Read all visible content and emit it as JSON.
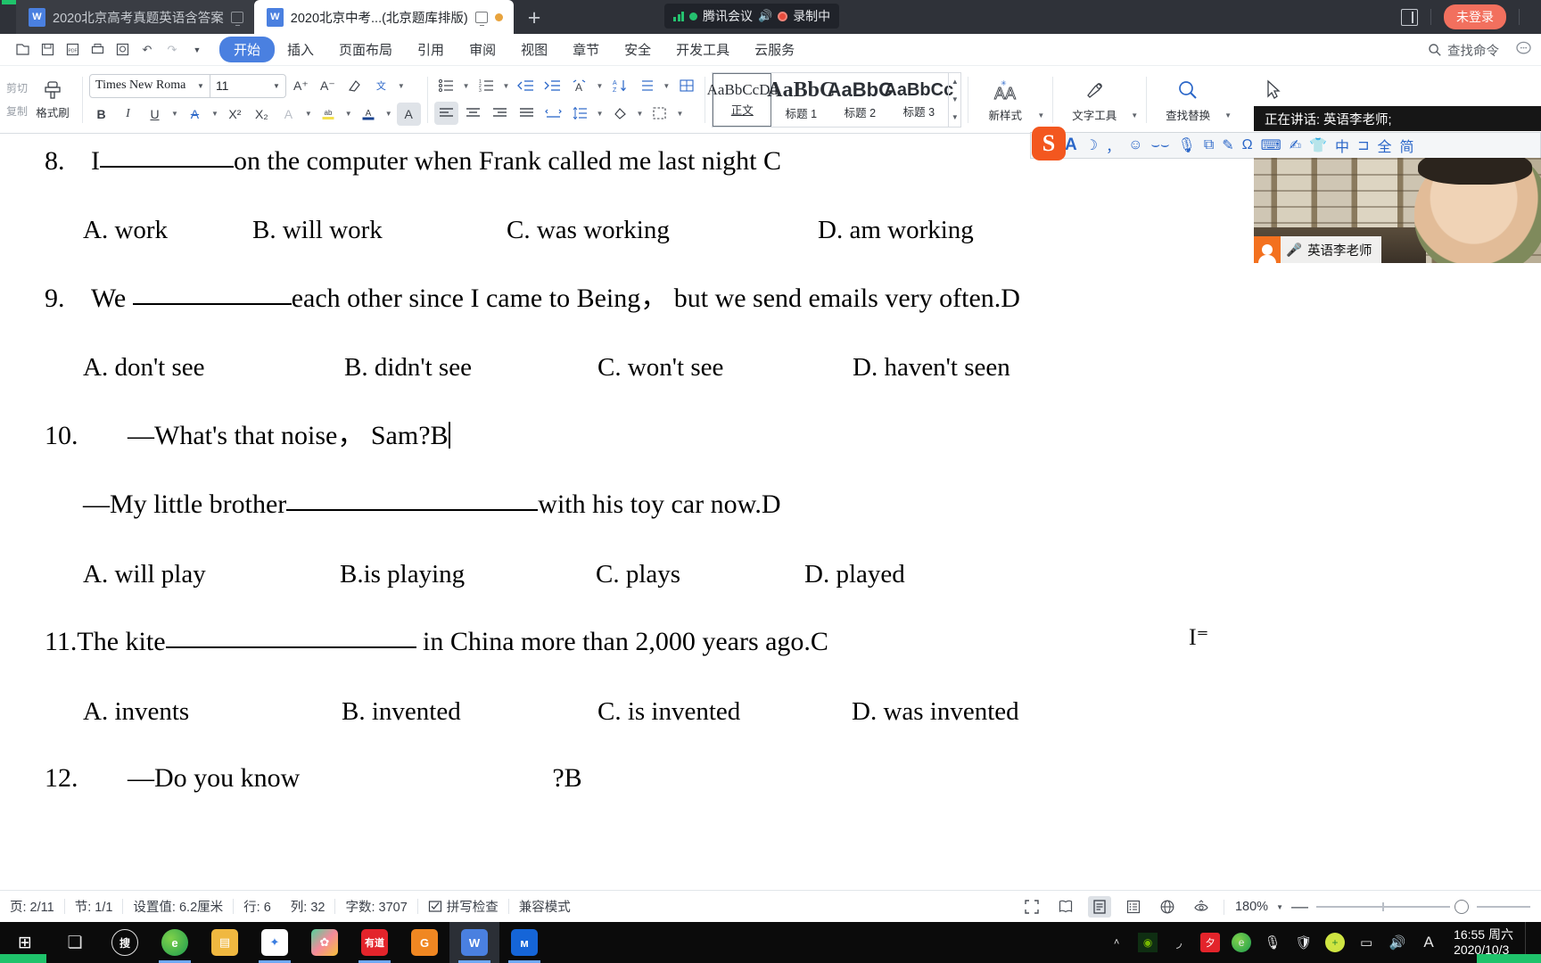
{
  "window": {
    "tabs": [
      {
        "title": "2020北京高考真题英语含答案",
        "state": "inactive",
        "icon": "word-doc-icon"
      },
      {
        "title": "2020北京中考...(北京题库排版)",
        "state": "active",
        "icon": "word-doc-icon"
      }
    ],
    "new_tab_label": "+",
    "meeting_pill": {
      "app": "腾讯会议",
      "recording": "录制中"
    },
    "login_button": "未登录"
  },
  "menubar": {
    "quick_icons": [
      "new-file-icon",
      "save-icon",
      "export-pdf-icon",
      "print-icon",
      "print-preview-icon",
      "undo-icon",
      "redo-icon",
      "customize-caret-icon"
    ],
    "items": [
      {
        "label": "开始",
        "active": true
      },
      {
        "label": "插入",
        "active": false
      },
      {
        "label": "页面布局",
        "active": false
      },
      {
        "label": "引用",
        "active": false
      },
      {
        "label": "审阅",
        "active": false
      },
      {
        "label": "视图",
        "active": false
      },
      {
        "label": "章节",
        "active": false
      },
      {
        "label": "安全",
        "active": false
      },
      {
        "label": "开发工具",
        "active": false
      },
      {
        "label": "云服务",
        "active": false
      }
    ],
    "find_command": "查找命令"
  },
  "ribbon": {
    "clipboard": {
      "cut": "剪切",
      "copy": "复制",
      "format_painter": "格式刷"
    },
    "font": {
      "name": "Times New Roma",
      "size": "11"
    },
    "styles": [
      {
        "sample": "AaBbCcDd",
        "name": "正文",
        "selected": true
      },
      {
        "sample": "AaBbC",
        "name": "标题 1",
        "selected": false
      },
      {
        "sample": "AaBbC",
        "name": "标题 2",
        "selected": false
      },
      {
        "sample": "AaBbCc",
        "name": "标题 3",
        "selected": false
      }
    ],
    "new_style": "新样式",
    "text_tools": "文字工具",
    "find_replace": "查找替换",
    "select": "选择"
  },
  "overlays": {
    "speaking": "正在讲话: 英语李老师;",
    "video_name": "英语李老师",
    "sogou_logo": "S",
    "sogou_tools": [
      "A",
      "moon-icon",
      "comma-icon",
      "smiley-icon",
      "expression-icon",
      "mic-icon",
      "screenshot-icon",
      "pen-icon",
      "omega-icon",
      "keyboard-icon",
      "handwriting-icon",
      "skin-icon",
      "translate-icon",
      "crop-icon",
      "full-width-icon",
      "simplified-icon"
    ]
  },
  "document": {
    "questions": [
      {
        "num": "8.",
        "text_before": "I",
        "blank_width": 150,
        "text_after": "on the computer when Frank called me last night C",
        "options": [
          "A. work",
          "B. will work",
          "C. was working",
          "D. am working"
        ]
      },
      {
        "num": "9.",
        "text_before": "We ",
        "blank_width": 178,
        "text_after": "each other since I came to Being，  but we send emails very often.D",
        "options": [
          "A.    don't see",
          "B. didn't see",
          "C. won't see",
          "D. haven't seen"
        ]
      },
      {
        "num": "10.",
        "line1": "—What's that noise，  Sam?B",
        "line2_before": "—My little brother",
        "line2_blank": 282,
        "line2_after": "with his toy car now.D",
        "options": [
          "A.    will play",
          "B.is playing",
          "C. plays",
          "D. played"
        ]
      },
      {
        "num": "11.",
        "text_before": "The kite",
        "blank_width": 281,
        "text_after": " in China more than 2,000 years ago.C",
        "options": [
          "A.    invents",
          "B. invented",
          "C. is invented",
          "D. was invented"
        ]
      },
      {
        "num": "12.",
        "text_before": "—Do you know",
        "text_after": "?B"
      }
    ]
  },
  "statusbar": {
    "page": "页: 2/11",
    "section": "节: 1/1",
    "value": "设置值: 6.2厘米",
    "row": "行: 6",
    "col": "列: 32",
    "words": "字数: 3707",
    "spellcheck": "拼写检查",
    "compat": "兼容模式",
    "zoom": "180%",
    "view_buttons": [
      "fullscreen-icon",
      "two-page-view-icon",
      "page-view-icon",
      "outline-view-icon",
      "web-view-icon",
      "eye-protect-icon"
    ]
  },
  "taskbar": {
    "start": "start-icon",
    "items": [
      "task-view-icon",
      "sogou-search-icon",
      "edge-browser-icon",
      "file-explorer-icon",
      "qq-mail-icon",
      "xmind-icon",
      "youdao-icon",
      "pdf-icon",
      "wps-writer-icon",
      "meitu-icon"
    ],
    "tray": [
      "nvidia-icon",
      "wifi-icon",
      "qq-icon",
      "360-browser-icon",
      "mic-icon",
      "security-shield-icon",
      "360-safe-icon",
      "battery-icon",
      "volume-icon",
      "ime-A-icon"
    ],
    "clock_time": "16:55 周六",
    "clock_date": "2020/10/3"
  },
  "colors": {
    "tabbar_bg": "#2f3239",
    "accent_blue": "#4a80e0",
    "login_red": "#f2705e",
    "green": "#1fc36b",
    "taskbar_bg": "#0b0b0b"
  }
}
